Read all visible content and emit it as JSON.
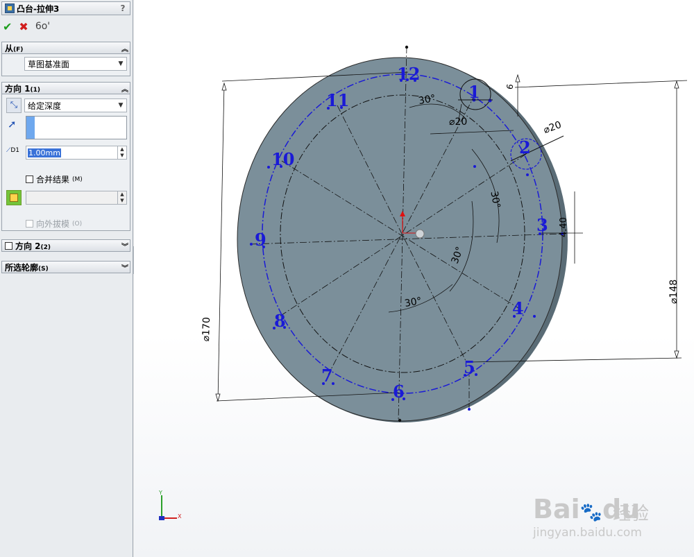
{
  "feature_panel": {
    "title": "凸台-拉伸3",
    "help": "?",
    "actions": {
      "ok": "✔",
      "cancel": "✖",
      "preview": "6o'"
    },
    "from": {
      "header": "从",
      "header_key": "(F)",
      "value": "草图基准面"
    },
    "direction1": {
      "header": "方向 1",
      "header_key": "(1)",
      "end_condition": "给定深度",
      "depth_label": "D1",
      "depth": "1.00mm",
      "merge_label": "合并结果",
      "merge_key": "(M)",
      "draft_label": "向外拔模",
      "draft_key": "(O)"
    },
    "direction2": {
      "header": "方向 2",
      "header_key": "(2)"
    },
    "contours": {
      "header": "所选轮廓",
      "header_key": "(S)"
    }
  },
  "viewport": {
    "clock_numbers": [
      "12",
      "1",
      "2",
      "3",
      "4",
      "5",
      "6",
      "7",
      "8",
      "9",
      "10",
      "11"
    ],
    "dimensions": {
      "outer_diameter": "170",
      "inner_diameter": "148",
      "hole1": "20",
      "hole2": "20",
      "dim_6": "6",
      "dim_440": "4.40",
      "angle_a": "30°",
      "angle_b": "30°",
      "angle_c": "30°",
      "angle_d": "30°"
    },
    "triad": {
      "y": "Y",
      "x": "X"
    },
    "watermark": {
      "brand": "Bai",
      "brand2": "du",
      "jingyan": "经验",
      "url": "jingyan.baidu.com"
    }
  },
  "colors": {
    "disc_fill": "#7b8f9a",
    "sketch_blue": "#1a1ad6",
    "panel_bg": "#e9ecef"
  }
}
